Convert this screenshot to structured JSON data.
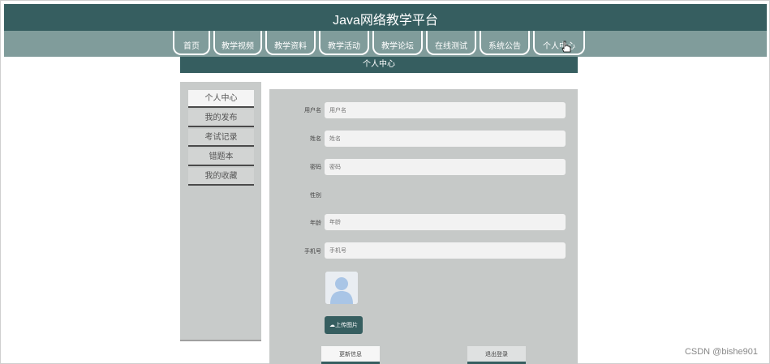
{
  "app": {
    "title": "Java网络教学平台"
  },
  "nav": {
    "items": [
      {
        "label": "首页"
      },
      {
        "label": "教学视频"
      },
      {
        "label": "教学资料"
      },
      {
        "label": "教学活动"
      },
      {
        "label": "教学论坛"
      },
      {
        "label": "在线测试"
      },
      {
        "label": "系统公告"
      },
      {
        "label": "个人中心"
      }
    ]
  },
  "section": {
    "title": "个人中心"
  },
  "sidebar": {
    "items": [
      {
        "label": "个人中心",
        "active": true
      },
      {
        "label": "我的发布"
      },
      {
        "label": "考试记录"
      },
      {
        "label": "错题本"
      },
      {
        "label": "我的收藏"
      }
    ]
  },
  "form": {
    "username": {
      "label": "用户名",
      "placeholder": "用户名"
    },
    "name": {
      "label": "姓名",
      "placeholder": "姓名"
    },
    "password": {
      "label": "密码",
      "placeholder": "密码"
    },
    "gender": {
      "label": "性别"
    },
    "age": {
      "label": "年龄",
      "placeholder": "年龄"
    },
    "phone": {
      "label": "手机号",
      "placeholder": "手机号"
    },
    "upload_label": "上传图片",
    "update_label": "更新信息",
    "logout_label": "退出登录"
  },
  "watermark": "CSDN @bishe901",
  "colors": {
    "primary": "#365e60",
    "nav": "#809c9b",
    "panel": "#c6c9c8"
  }
}
